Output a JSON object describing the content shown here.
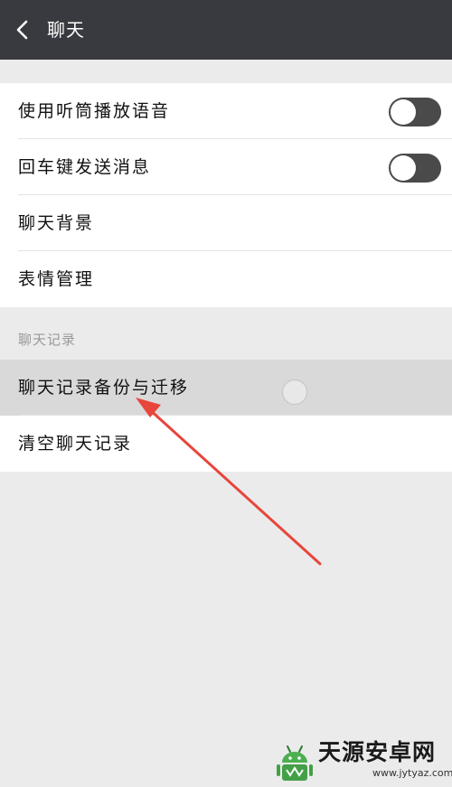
{
  "header": {
    "title": "聊天",
    "back_icon": "chevron-left-icon"
  },
  "settings": [
    {
      "label": "使用听筒播放语音",
      "toggle": true,
      "toggle_on": false
    },
    {
      "label": "回车键发送消息",
      "toggle": true,
      "toggle_on": false
    },
    {
      "label": "聊天背景",
      "toggle": false
    },
    {
      "label": "表情管理",
      "toggle": false
    }
  ],
  "history_section": {
    "header": "聊天记录",
    "items": [
      {
        "label": "聊天记录备份与迁移",
        "pressed": true
      },
      {
        "label": "清空聊天记录",
        "pressed": false
      }
    ]
  },
  "annotation": {
    "color": "#e8453c",
    "icon": "red-arrow-pointer"
  },
  "watermark": {
    "title": "天源安卓网",
    "url": "www.jytyaz.com",
    "logo": "android-logo-icon"
  },
  "colors": {
    "header_bg": "#393a3f",
    "page_bg": "#ebebeb",
    "toggle_off": "#4a4a4a"
  }
}
